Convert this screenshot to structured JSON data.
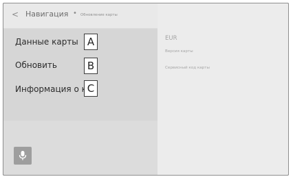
{
  "header": {
    "back_glyph": "<",
    "title": "Навигация",
    "separator": "•",
    "subtitle": "Обновление карты"
  },
  "menu": {
    "items": [
      {
        "label": "Данные карты",
        "callout": "A"
      },
      {
        "label": "Обновить",
        "callout": "B"
      },
      {
        "label": "Информация о карте",
        "callout": "C"
      }
    ]
  },
  "details": {
    "region": "EUR",
    "version_label": "Версия карты",
    "service_code_label": "Сервисный код карты"
  },
  "icons": {
    "voice": "microphone-icon"
  }
}
